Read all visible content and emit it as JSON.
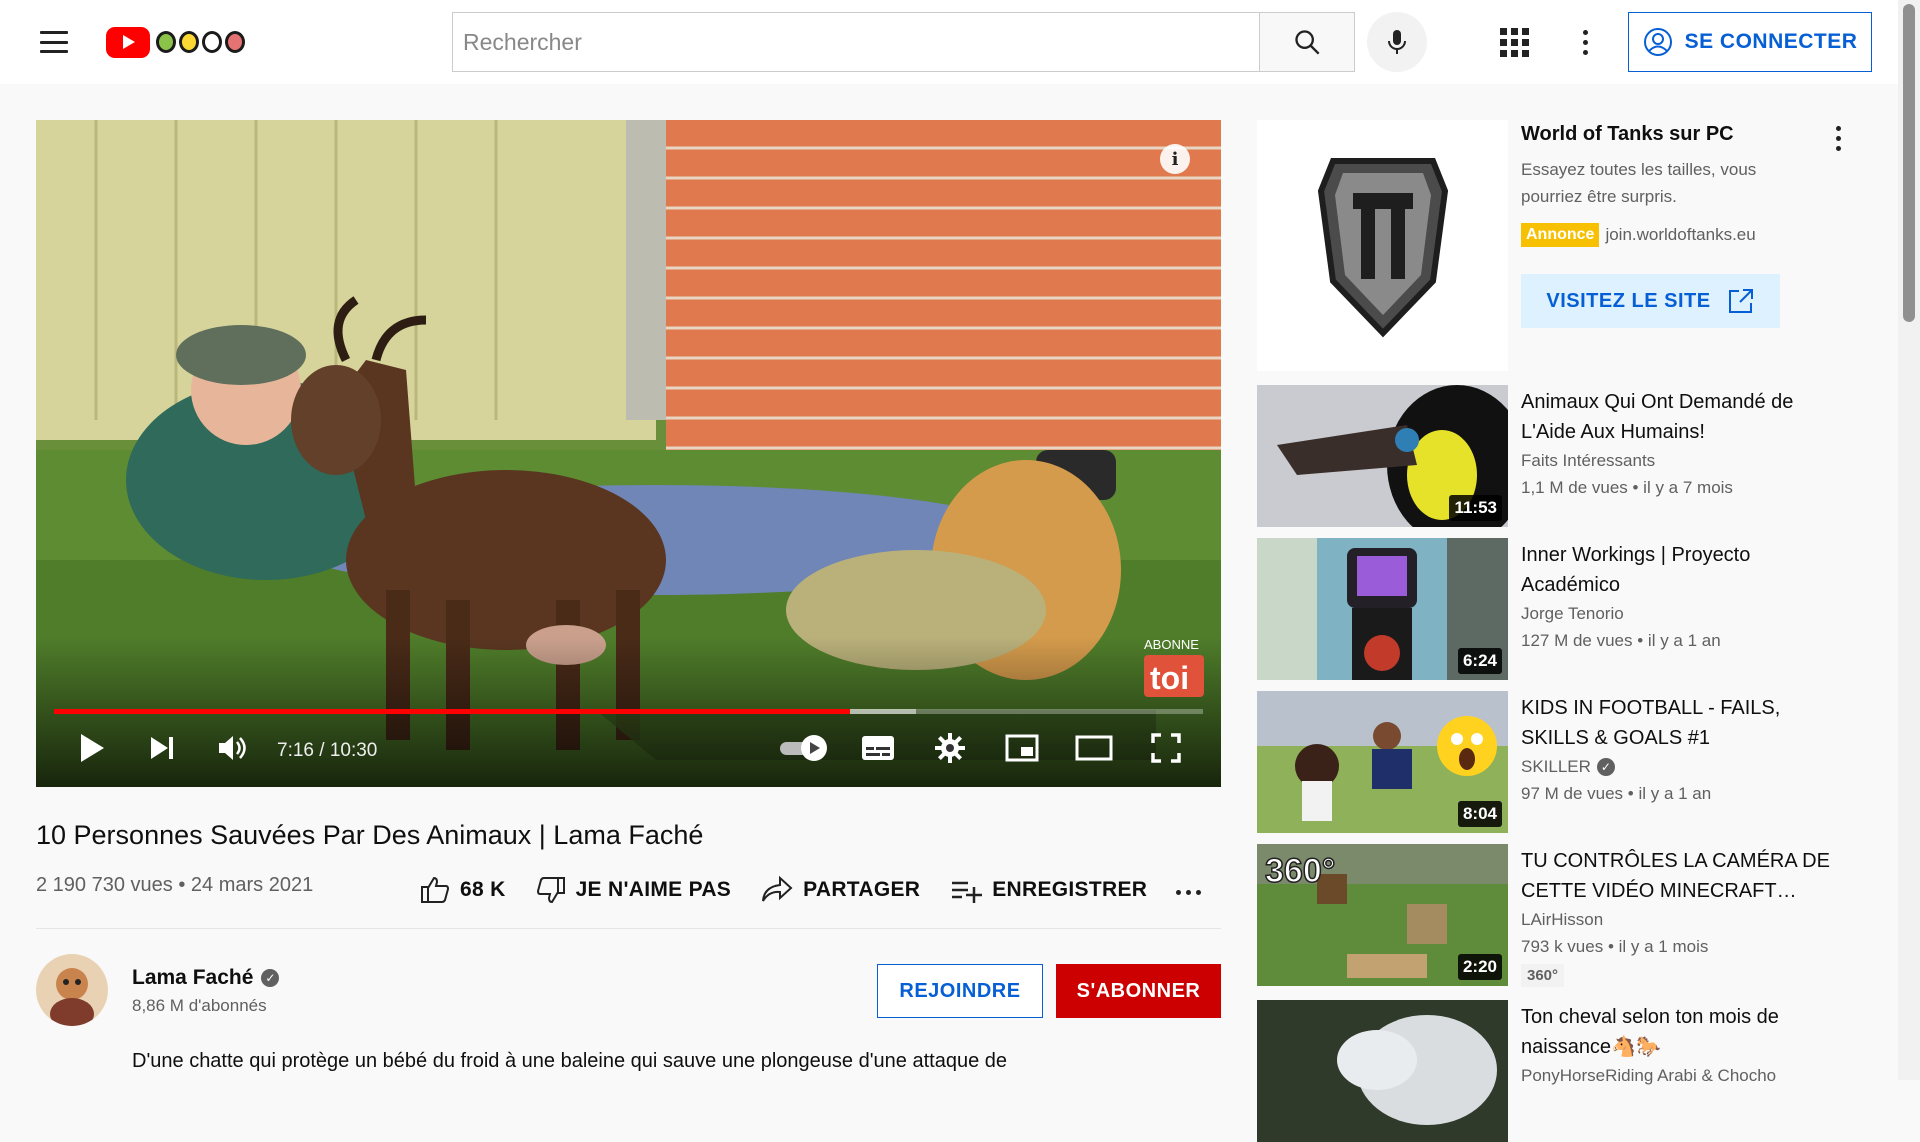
{
  "header": {
    "search_placeholder": "Rechercher",
    "signin_label": "SE CONNECTER",
    "icons": [
      "menu-icon",
      "youtube-logo",
      "search-icon",
      "mic-icon",
      "apps-icon",
      "more-icon",
      "account-icon"
    ]
  },
  "player": {
    "time": "7:16 / 10:30",
    "progress_played": 0.6925,
    "progress_buffered": 0.75,
    "watermark_top": "ABONNE",
    "watermark_bottom": "toi",
    "accent_color": "#ff0000"
  },
  "video": {
    "title": "10 Personnes Sauvées Par Des Animaux | Lama Faché",
    "views_date": "2 190 730 vues • 24 mars 2021",
    "like_label": "68 K",
    "dislike_label": "JE N'AIME PAS",
    "share_label": "PARTAGER",
    "save_label": "ENREGISTRER"
  },
  "channel": {
    "name": "Lama Faché",
    "subscribers": "8,86 M d'abonnés",
    "join_label": "REJOINDRE",
    "subscribe_label": "S'ABONNER",
    "description": "D'une chatte qui protège un bébé du froid à une baleine qui sauve une plongeuse d'une attaque de"
  },
  "ad": {
    "title": "World of Tanks sur PC",
    "description": "Essayez toutes les tailles, vous pourriez être surpris.",
    "badge": "Annonce",
    "domain": "join.worldoftanks.eu",
    "cta": "VISITEZ LE SITE"
  },
  "recommendations": [
    {
      "title": "Animaux Qui Ont Demandé de L'Aide Aux Humains!",
      "channel": "Faits Intéressants",
      "meta": "1,1 M de vues • il y a 7 mois",
      "duration": "11:53"
    },
    {
      "title": "Inner Workings | Proyecto Académico",
      "channel": "Jorge Tenorio",
      "meta": "127 M de vues • il y a 1 an",
      "duration": "6:24"
    },
    {
      "title": "KIDS IN FOOTBALL - FAILS, SKILLS & GOALS #1",
      "channel": "SKILLER",
      "meta": "97 M de vues • il y a 1 an",
      "duration": "8:04"
    },
    {
      "title": "TU CONTRÔLES LA CAMÉRA DE CETTE VIDÉO MINECRAFT…",
      "channel": "LAirHisson",
      "meta": "793 k vues • il y a 1 mois",
      "duration": "2:20",
      "badge": "360°",
      "thumb_text": "360°"
    },
    {
      "title": "Ton cheval selon ton mois de naissance🐴🐎",
      "channel": "PonyHorseRiding Arabi & Chocho",
      "meta": "",
      "duration": ""
    }
  ]
}
